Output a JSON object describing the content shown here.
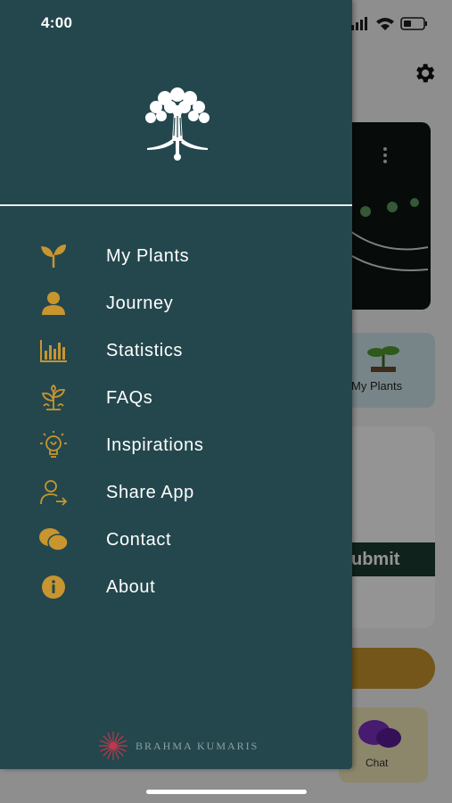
{
  "status_bar": {
    "time": "4:00"
  },
  "drawer": {
    "menu": [
      {
        "label": "My Plants",
        "icon": "sprout-icon"
      },
      {
        "label": "Journey",
        "icon": "user-icon"
      },
      {
        "label": "Statistics",
        "icon": "bar-chart-icon"
      },
      {
        "label": "FAQs",
        "icon": "plant-pot-icon"
      },
      {
        "label": "Inspirations",
        "icon": "lightbulb-icon"
      },
      {
        "label": "Share App",
        "icon": "share-user-icon"
      },
      {
        "label": "Contact",
        "icon": "chat-bubbles-icon"
      },
      {
        "label": "About",
        "icon": "info-icon"
      }
    ],
    "footer_brand": "BRAHMA KUMARIS"
  },
  "background": {
    "my_plants_label": "My Plants",
    "submit_label": "ubmit",
    "chat_label": "Chat"
  },
  "colors": {
    "drawer_bg": "#23474d",
    "icon_accent": "#c8952e",
    "text": "#ffffff"
  }
}
